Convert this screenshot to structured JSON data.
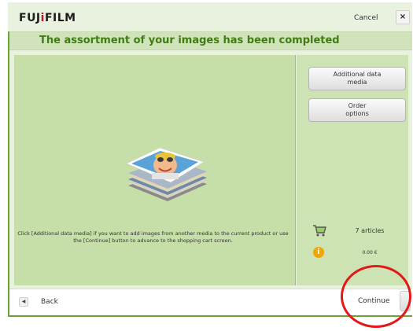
{
  "header": {
    "brand_text": "FUJ",
    "brand_dot": "i",
    "brand_rest": "FILM",
    "cancel_label": "Cancel",
    "close_glyph": "×"
  },
  "title": "The assortment of your images has been completed",
  "main": {
    "instructions": "Click [Additional data media] if you want to add images from another media to the current product or use the [Continue] button to advance to the shopping cart screen."
  },
  "sidebar": {
    "additional_line1": "Additional data",
    "additional_line2": "media",
    "order_line1": "Order",
    "order_line2": "options",
    "articles": "7 articles",
    "amount": "0.00 €",
    "info_glyph": "i"
  },
  "footer": {
    "back_arrow": "◀",
    "back_label": "Back",
    "continue_label": "Continue"
  },
  "colors": {
    "title_green": "#3e7d12",
    "panel_green": "#c6dfa8",
    "accent_rule": "#6aa436",
    "annotation_red": "#e31818"
  },
  "icons": {
    "cart": "shopping-cart-icon",
    "info": "info-icon",
    "close": "close-icon",
    "back": "back-arrow-icon"
  }
}
